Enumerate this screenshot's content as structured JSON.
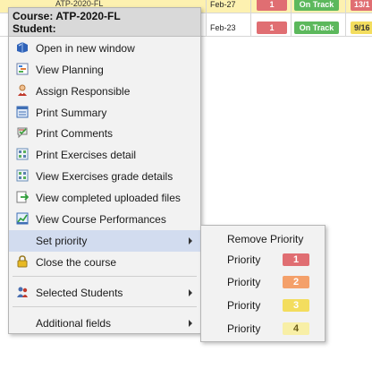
{
  "table": {
    "rows": [
      {
        "course": "ATP-2020-FL",
        "date": "Feb-27",
        "priority": "1",
        "status": "On Track",
        "extra": "13/1"
      },
      {
        "course": "",
        "date": "Feb-23",
        "priority": "1",
        "status": "On Track",
        "extra": "9/16"
      }
    ]
  },
  "menu": {
    "header_course": "Course: ATP-2020-FL",
    "header_student": "Student:",
    "items": [
      {
        "label": "Open in new window",
        "icon": "book-icon"
      },
      {
        "label": "View Planning",
        "icon": "planning-icon"
      },
      {
        "label": "Assign Responsible",
        "icon": "person-icon"
      },
      {
        "label": "Print Summary",
        "icon": "summary-icon"
      },
      {
        "label": "Print Comments",
        "icon": "comments-icon"
      },
      {
        "label": "Print Exercises detail",
        "icon": "exercises-icon"
      },
      {
        "label": "View Exercises grade details",
        "icon": "grades-icon"
      },
      {
        "label": "View completed uploaded files",
        "icon": "upload-icon"
      },
      {
        "label": "View Course Performances",
        "icon": "chart-icon"
      },
      {
        "label": "Set priority",
        "icon": ""
      },
      {
        "label": "Close the course",
        "icon": "lock-icon"
      },
      {
        "label": "Selected Students",
        "icon": "students-icon"
      },
      {
        "label": "Additional fields",
        "icon": ""
      }
    ]
  },
  "submenu": {
    "remove_label": "Remove Priority",
    "priorities": [
      {
        "label": "Priority",
        "value": "1",
        "color": "#e06e72",
        "text_color": "#ffffff"
      },
      {
        "label": "Priority",
        "value": "2",
        "color": "#f4a06a",
        "text_color": "#ffffff"
      },
      {
        "label": "Priority",
        "value": "3",
        "color": "#f3dd5e",
        "text_color": "#ffffff"
      },
      {
        "label": "Priority",
        "value": "4",
        "color": "#f8efa6",
        "text_color": "#6b5d18"
      }
    ]
  },
  "colors": {
    "status_green": "#5cb85c",
    "priority_red": "#e06e72",
    "active_item_bg": "#d2dcef"
  }
}
